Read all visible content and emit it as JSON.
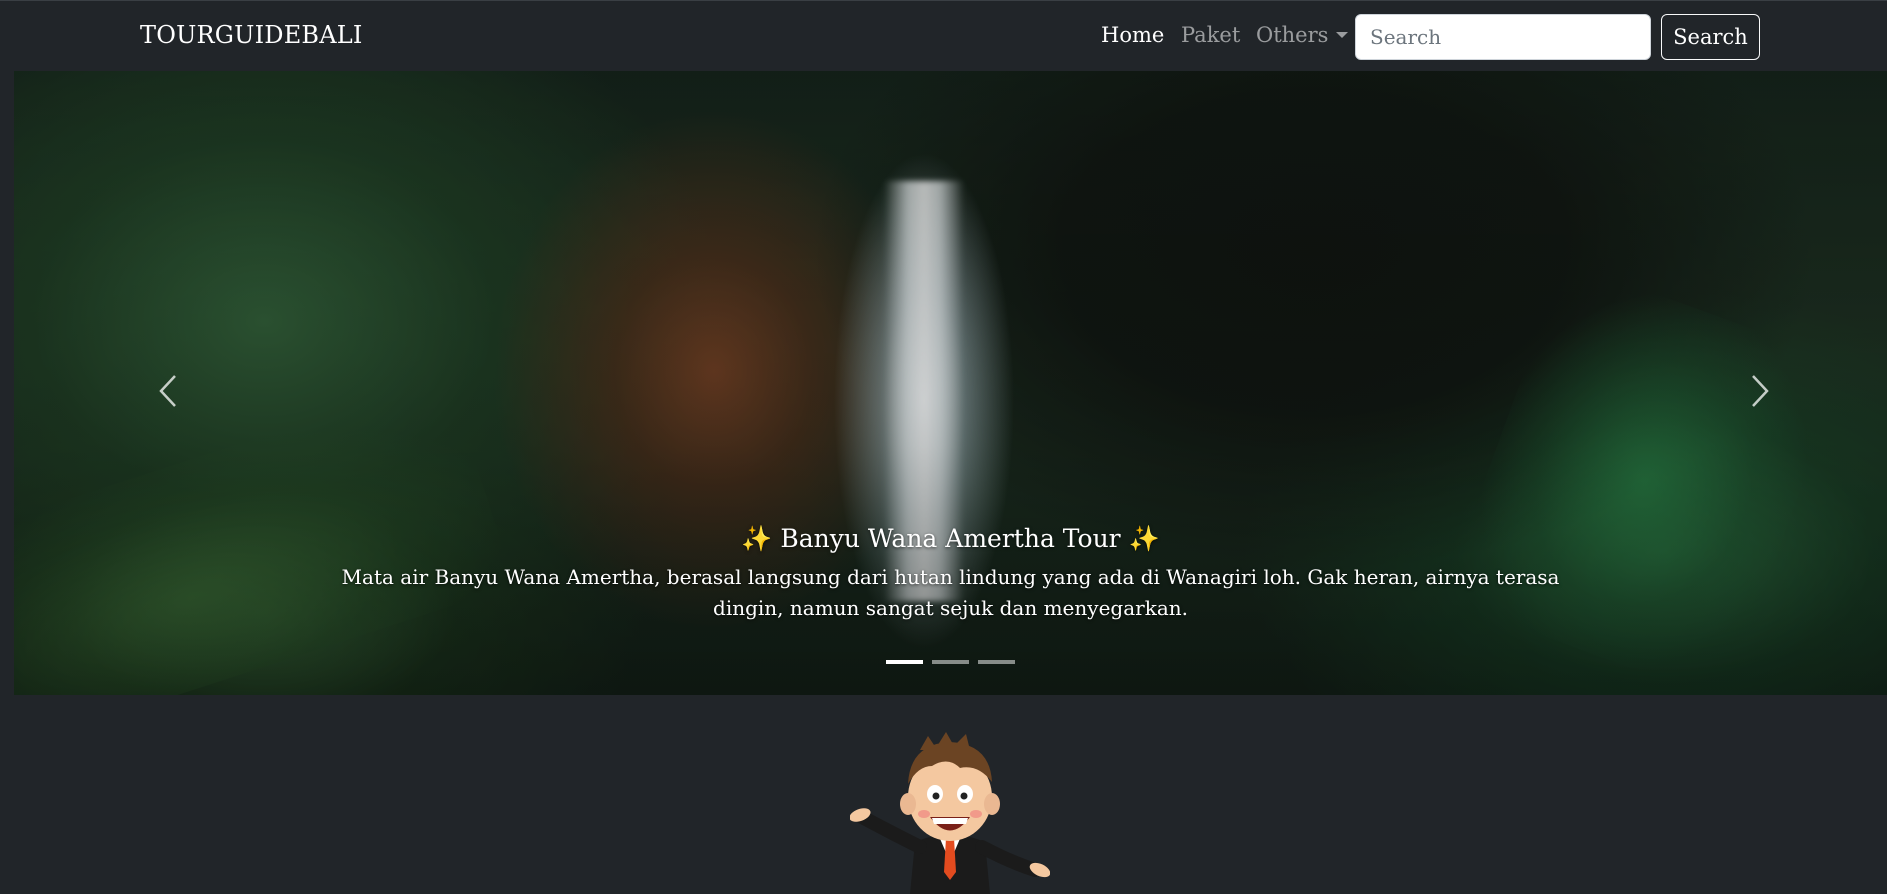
{
  "navbar": {
    "brand": "TOURGUIDEBALI",
    "links": [
      {
        "label": "Home",
        "active": true
      },
      {
        "label": "Paket",
        "active": false
      },
      {
        "label": "Others",
        "active": false,
        "dropdown": true
      }
    ],
    "search_placeholder": "Search",
    "search_button": "Search"
  },
  "carousel": {
    "slide": {
      "title": "Banyu Wana Amertha Tour",
      "title_emoji": "✨",
      "text": "Mata air Banyu Wana Amertha, berasal langsung dari hutan lindung yang ada di Wanagiri loh. Gak heran, airnya terasa dingin, namun sangat sejuk dan menyegarkan."
    },
    "indicators_count": 3,
    "active_indicator": 1,
    "prev_icon": "chevron-left-icon",
    "next_icon": "chevron-right-icon"
  },
  "colors": {
    "background": "#212529",
    "accent_sparkle": "#f5c542"
  }
}
